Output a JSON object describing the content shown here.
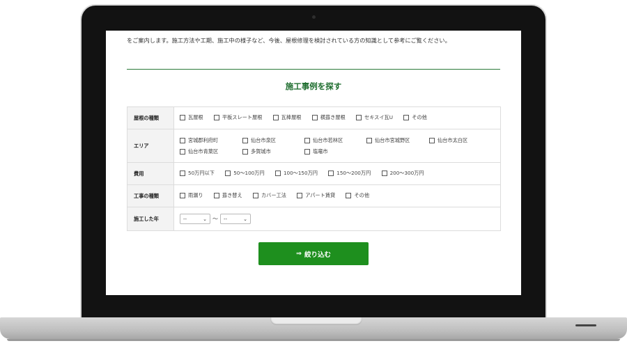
{
  "intro": {
    "text": "をご案内します。施工方法や工期、施工中の様子など、今後、屋根修理を検討されている方の知識として参考にご覧ください。"
  },
  "search": {
    "title": "施工事例を探す"
  },
  "filters": {
    "roof_type": {
      "label": "屋根の種類",
      "options": [
        "瓦屋根",
        "平板スレート屋根",
        "瓦棒屋根",
        "横葺き屋根",
        "セキスイ瓦U",
        "その他"
      ]
    },
    "area": {
      "label": "エリア",
      "options": [
        "宮城郡利府町",
        "仙台市泉区",
        "仙台市若林区",
        "仙台市宮城野区",
        "仙台市太白区",
        "仙台市青葉区",
        "多賀城市",
        "塩竈市"
      ]
    },
    "cost": {
      "label": "費用",
      "options": [
        "50万円以下",
        "50〜100万円",
        "100〜150万円",
        "150〜200万円",
        "200〜300万円"
      ]
    },
    "work_type": {
      "label": "工事の種類",
      "options": [
        "雨漏り",
        "葺き替え",
        "カバー工法",
        "アパート賃貸",
        "その他"
      ]
    },
    "year": {
      "label": "施工した年",
      "from": "--",
      "separator": "〜",
      "to": "--"
    }
  },
  "submit": {
    "icon": "⇒",
    "label": "絞り込む"
  }
}
